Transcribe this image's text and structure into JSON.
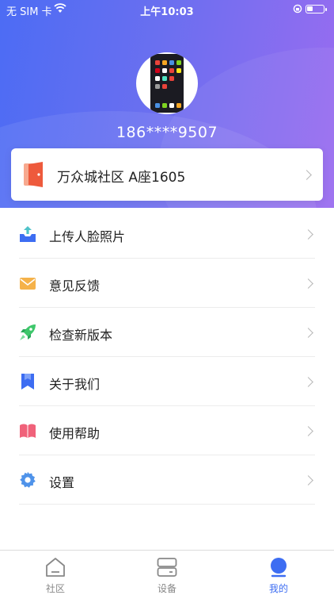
{
  "status_bar": {
    "carrier": "无 SIM 卡",
    "time": "上午10:03",
    "battery_level": 0.35
  },
  "profile": {
    "phone": "186****9507"
  },
  "community": {
    "label": "万众城社区 A座1605"
  },
  "menu": {
    "items": [
      {
        "label": "上传人脸照片",
        "icon": "upload-icon"
      },
      {
        "label": "意见反馈",
        "icon": "mail-icon"
      },
      {
        "label": "检查新版本",
        "icon": "rocket-icon"
      },
      {
        "label": "关于我们",
        "icon": "bookmark-icon"
      },
      {
        "label": "使用帮助",
        "icon": "book-icon"
      },
      {
        "label": "设置",
        "icon": "gear-icon"
      }
    ]
  },
  "tabbar": {
    "tabs": [
      {
        "label": "社区",
        "icon": "home-icon"
      },
      {
        "label": "设备",
        "icon": "device-icon"
      },
      {
        "label": "我的",
        "icon": "profile-icon",
        "active": true
      }
    ]
  },
  "colors": {
    "accent": "#3d6df2",
    "header_start": "#4c6cf4",
    "header_end": "#9a6cf0"
  }
}
